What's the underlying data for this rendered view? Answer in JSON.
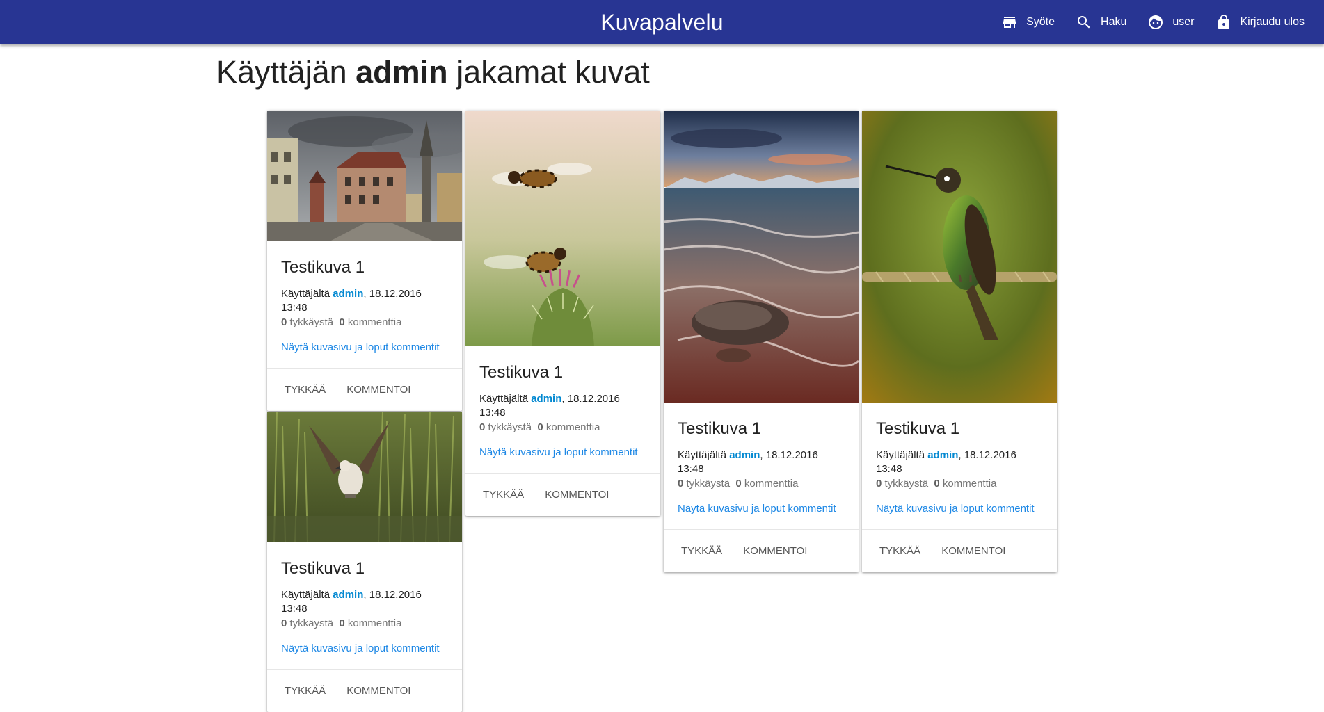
{
  "app": {
    "title": "Kuvapalvelu",
    "colors": {
      "appbar": "#283593",
      "link": "#0288d1"
    }
  },
  "nav": [
    {
      "label": "Syöte",
      "icon": "store-icon"
    },
    {
      "label": "Haku",
      "icon": "search-icon"
    },
    {
      "label": "user",
      "icon": "face-icon"
    },
    {
      "label": "Kirjaudu ulos",
      "icon": "lock-icon"
    }
  ],
  "heading": {
    "prefix": "Käyttäjän",
    "username": "admin",
    "suffix": "jakamat kuvat"
  },
  "cards": [
    {
      "image": "old-town-street-photo",
      "title": "Testikuva 1",
      "by_prefix": "Käyttäjältä",
      "user": "admin",
      "date": ", 18.12.2016 13:48",
      "likes": "0",
      "likes_label": "tykkäystä",
      "comments": "0",
      "comments_label": "kommenttia",
      "more_link": "Näytä kuvasivu ja loput kommentit",
      "like_button": "Tykkää",
      "comment_button": "Kommentoi"
    },
    {
      "image": "bees-on-thistle-photo",
      "title": "Testikuva 1",
      "by_prefix": "Käyttäjältä",
      "user": "admin",
      "date": ", 18.12.2016 13:48",
      "likes": "0",
      "likes_label": "tykkäystä",
      "comments": "0",
      "comments_label": "kommenttia",
      "more_link": "Näytä kuvasivu ja loput kommentit",
      "like_button": "Tykkää",
      "comment_button": "Kommentoi"
    },
    {
      "image": "sea-waves-rock-photo",
      "title": "Testikuva 1",
      "by_prefix": "Käyttäjältä",
      "user": "admin",
      "date": ", 18.12.2016 13:48",
      "likes": "0",
      "likes_label": "tykkäystä",
      "comments": "0",
      "comments_label": "kommenttia",
      "more_link": "Näytä kuvasivu ja loput kommentit",
      "like_button": "Tykkää",
      "comment_button": "Kommentoi"
    },
    {
      "image": "hummingbird-photo",
      "title": "Testikuva 1",
      "by_prefix": "Käyttäjältä",
      "user": "admin",
      "date": ", 18.12.2016 13:48",
      "likes": "0",
      "likes_label": "tykkäystä",
      "comments": "0",
      "comments_label": "kommenttia",
      "more_link": "Näytä kuvasivu ja loput kommentit",
      "like_button": "Tykkää",
      "comment_button": "Kommentoi"
    },
    {
      "image": "osprey-photo",
      "title": "Testikuva 1",
      "by_prefix": "Käyttäjältä",
      "user": "admin",
      "date": ", 18.12.2016 13:48",
      "likes": "0",
      "likes_label": "tykkäystä",
      "comments": "0",
      "comments_label": "kommenttia",
      "more_link": "Näytä kuvasivu ja loput kommentit",
      "like_button": "Tykkää",
      "comment_button": "Kommentoi"
    }
  ]
}
